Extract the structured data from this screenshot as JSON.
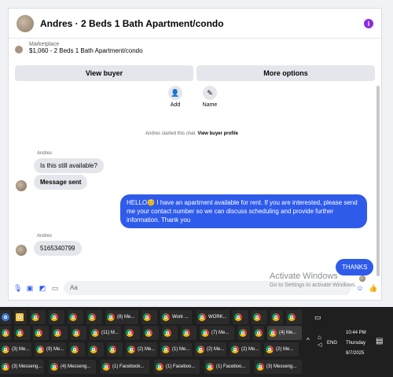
{
  "chat": {
    "title": "Andres · 2 Beds 1 Bath Apartment/condo",
    "marketplace_label": "Marketplace",
    "item": "$1,060 - 2 Beds 1 Bath Apartment/condo",
    "view_buyer": "View buyer",
    "more_options": "More options",
    "add_label": "Add",
    "name_label": "Name",
    "started_text": "Andres started this chat.",
    "view_profile": "View buyer profile",
    "sender1": "Andres",
    "msg1": "Is this still available?",
    "msg2": "Message sent",
    "msg3": "HELLO😊 I have an apartment available for rent. If you are interested, please send me your contact number so we can discuss scheduling and provide further information. Thank you",
    "sender2": "Andres",
    "msg4": "5165340799",
    "msg5": "THANKS",
    "composer_placeholder": "Aa"
  },
  "watermark": {
    "line1": "Activate Windows",
    "line2": "Go to Settings to activate Windows."
  },
  "taskbar": {
    "items": [
      "(8) Me...",
      "Work ...",
      "WORK...",
      "(11) M...",
      "(7) Me...",
      "(4) Me...",
      "(3) Me...",
      "(9) Me...",
      "(2) Me...",
      "(1) Me...",
      "(2) Me...",
      "(2) Me...",
      "(2) Me...",
      "(3) Messeng...",
      "(4) Messeng...",
      "(1) Facebook...",
      "(1) Faceboo...",
      "(1) Faceboo...",
      "(3) Messeng..."
    ],
    "lang": "ENG",
    "time": "10:44 PM",
    "day": "Thursday",
    "date": "8/7/2025"
  },
  "colors": {
    "accent": "#2f5bea",
    "info": "#8a2be2",
    "taskbar": "#1f1f1f"
  }
}
